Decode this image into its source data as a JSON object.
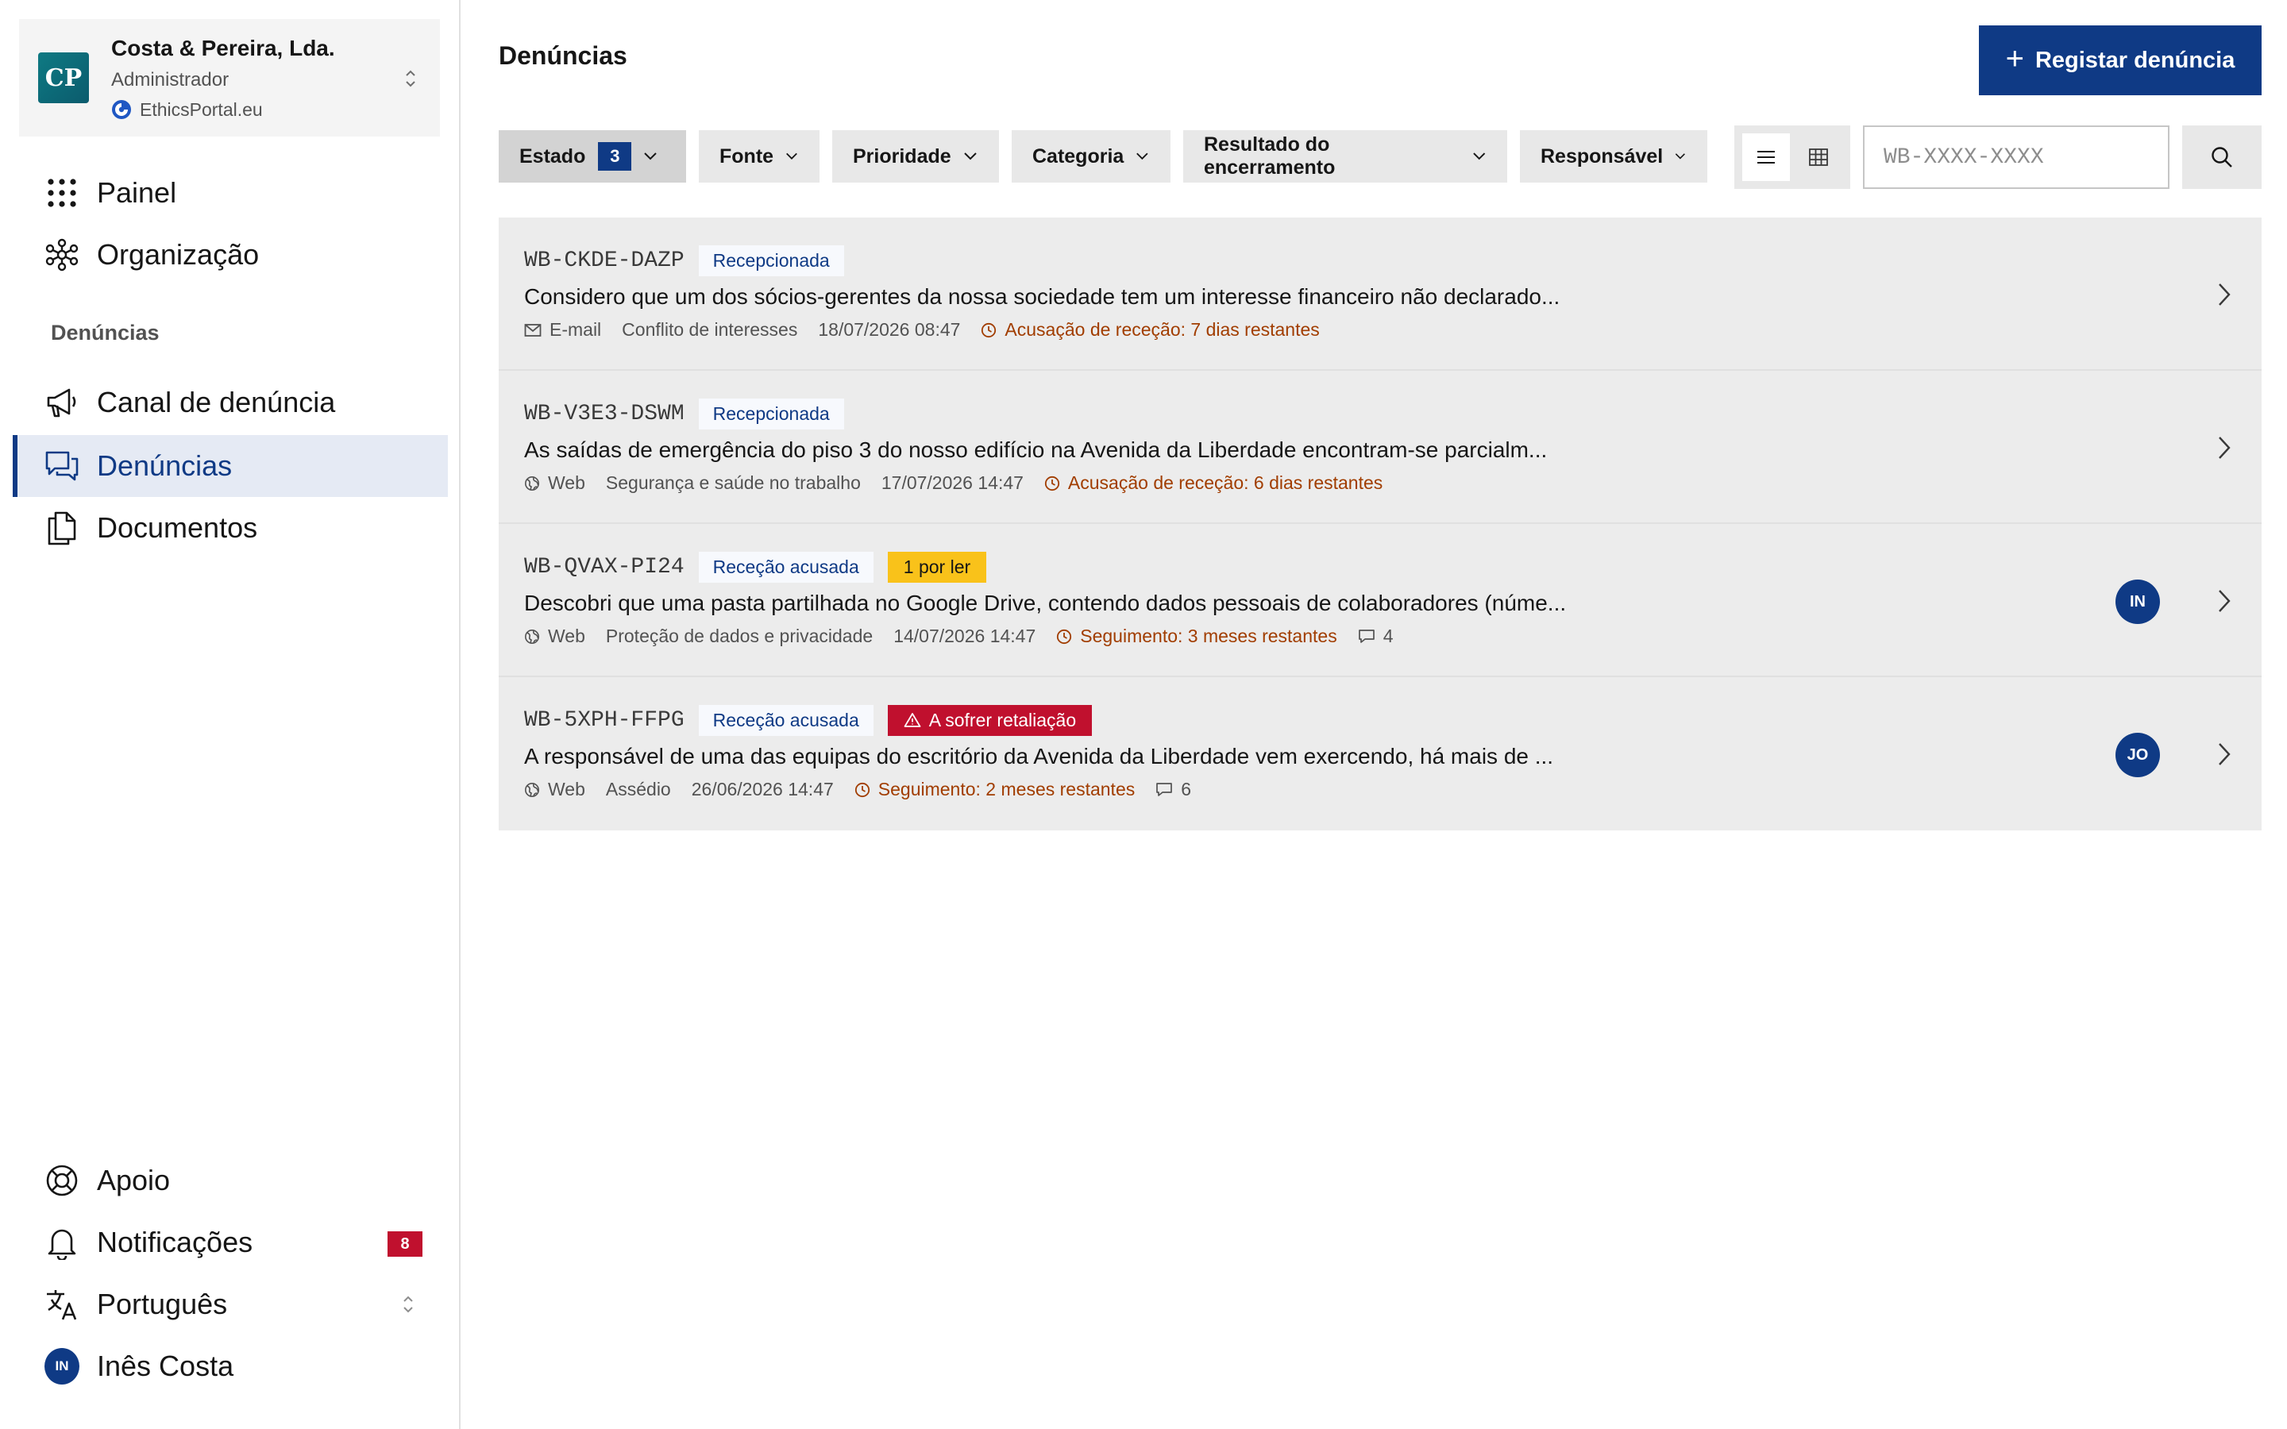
{
  "colors": {
    "brand": "#0f3a85",
    "active_nav_bg": "#e5eaf4",
    "danger": "#c0102e",
    "warning": "#f9c21a",
    "deadline": "#a13d00",
    "row_bg": "#ececec"
  },
  "org": {
    "initials": "CP",
    "name": "Costa & Pereira, Lda.",
    "role": "Administrador",
    "portal": "EthicsPortal.eu"
  },
  "nav": {
    "main": [
      {
        "label": "Painel",
        "icon": "grid-dots-icon"
      },
      {
        "label": "Organização",
        "icon": "org-tree-icon"
      }
    ],
    "section_label": "Denúncias",
    "reports_section": [
      {
        "label": "Canal de denúncia",
        "icon": "megaphone-icon"
      },
      {
        "label": "Denúncias",
        "icon": "chat-bubbles-icon",
        "active": true
      },
      {
        "label": "Documentos",
        "icon": "documents-icon"
      }
    ],
    "bottom": {
      "support": "Apoio",
      "notifications": "Notificações",
      "notifications_count": "8",
      "language": "Português",
      "user_initials": "IN",
      "user_name": "Inês Costa"
    }
  },
  "header": {
    "title": "Denúncias",
    "new_button": "Registar denúncia"
  },
  "filters": [
    {
      "label": "Estado",
      "count": "3"
    },
    {
      "label": "Fonte"
    },
    {
      "label": "Prioridade"
    },
    {
      "label": "Categoria"
    },
    {
      "label": "Resultado do encerramento"
    },
    {
      "label": "Responsável"
    }
  ],
  "search": {
    "placeholder": "WB-XXXX-XXXX",
    "value": ""
  },
  "reports": [
    {
      "code": "WB-CKDE-DAZP",
      "status": "Recepcionada",
      "description": "Considero que um dos sócios-gerentes da nossa sociedade tem um interesse financeiro não declarado...",
      "source": "E-mail",
      "source_icon": "envelope-icon",
      "category": "Conflito de interesses",
      "date": "18/07/2026 08:47",
      "deadline": "Acusação de receção: 7 dias restantes"
    },
    {
      "code": "WB-V3E3-DSWM",
      "status": "Recepcionada",
      "description": "As saídas de emergência do piso 3 do nosso edifício na Avenida da Liberdade encontram-se parcialm...",
      "source": "Web",
      "source_icon": "globe-icon",
      "category": "Segurança e saúde no trabalho",
      "date": "17/07/2026 14:47",
      "deadline": "Acusação de receção: 6 dias restantes"
    },
    {
      "code": "WB-QVAX-PI24",
      "status": "Receção acusada",
      "tag": "1 por ler",
      "description": "Descobri que uma pasta partilhada no Google Drive, contendo dados pessoais de colaboradores (núme...",
      "source": "Web",
      "source_icon": "globe-icon",
      "category": "Proteção de dados e privacidade",
      "date": "14/07/2026 14:47",
      "deadline": "Seguimento: 3 meses restantes",
      "comments": "4",
      "assignee": "IN"
    },
    {
      "code": "WB-5XPH-FFPG",
      "status": "Receção acusada",
      "tag": "A sofrer retaliação",
      "description": "A responsável de uma das equipas do escritório da Avenida da Liberdade vem exercendo, há mais de ...",
      "source": "Web",
      "source_icon": "globe-icon",
      "category": "Assédio",
      "date": "26/06/2026 14:47",
      "deadline": "Seguimento: 2 meses restantes",
      "comments": "6",
      "assignee": "JO"
    }
  ]
}
